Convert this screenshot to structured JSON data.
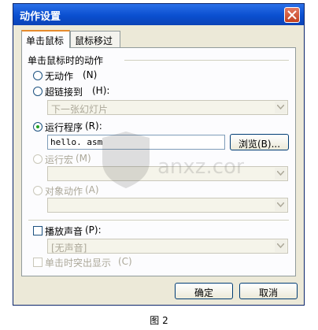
{
  "window": {
    "title": "动作设置"
  },
  "tabs": [
    {
      "label": "单击鼠标",
      "active": true
    },
    {
      "label": "鼠标移过",
      "active": false
    }
  ],
  "group": {
    "title": "单击鼠标时的动作"
  },
  "options": {
    "none": {
      "label": "无动作",
      "key": "(N)"
    },
    "hyperlink": {
      "label": "超链接到",
      "key": "(H):",
      "combo_value": "下一张幻灯片"
    },
    "run_program": {
      "label": "运行程序",
      "key": "(R):",
      "value": "hello. asm",
      "browse_label": "浏览",
      "browse_key": "(B)..."
    },
    "run_macro": {
      "label": "运行宏",
      "key": "(M)"
    },
    "object_action": {
      "label": "对象动作",
      "key": "(A)"
    }
  },
  "sound": {
    "label": "播放声音",
    "key": "(P):",
    "combo_value": "[无声音]"
  },
  "highlight": {
    "label": "单击时突出显示",
    "key": "(C)"
  },
  "buttons": {
    "ok": "确定",
    "cancel": "取消"
  },
  "caption": "图 2",
  "watermark": {
    "text": "anxz.com"
  },
  "colors": {
    "title_bar": "#0a4fd0",
    "dialog_bg": "#ece9d8",
    "selected_radio": "#21a121"
  }
}
